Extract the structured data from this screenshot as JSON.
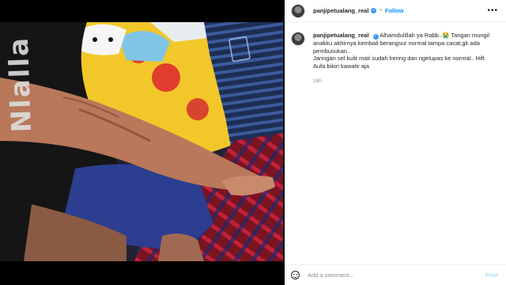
{
  "post": {
    "username": "panjipetualang_real",
    "follow_label": "Follow",
    "separator": "•",
    "more_label": "•••",
    "caption_lines": [
      " Alhamdulillah ya Rabb..😭 Tangan mungil",
      "anakku akhirnya kembali berangsur normal tampa cacat,gk ada",
      "pembusukan..",
      "Jaringan sel kulit mati sudah kering dan ngelupas ke normal.. Hift",
      "Aufa bikin kawatir aja"
    ],
    "time_ago": "16h"
  },
  "photo": {
    "shirt_text": "Nlalla",
    "description_colors": {
      "shirt": "#151515",
      "bedsheet_yellow": "#f2c72a",
      "stripes_blue": "#2f4f8a",
      "skin": "#b9785a"
    }
  },
  "comment": {
    "placeholder": "Add a comment...",
    "post_label": "Post"
  },
  "colors": {
    "accent": "#0095f6",
    "verified": "#3897f0",
    "text": "#262626",
    "muted": "#8e8e8e"
  }
}
